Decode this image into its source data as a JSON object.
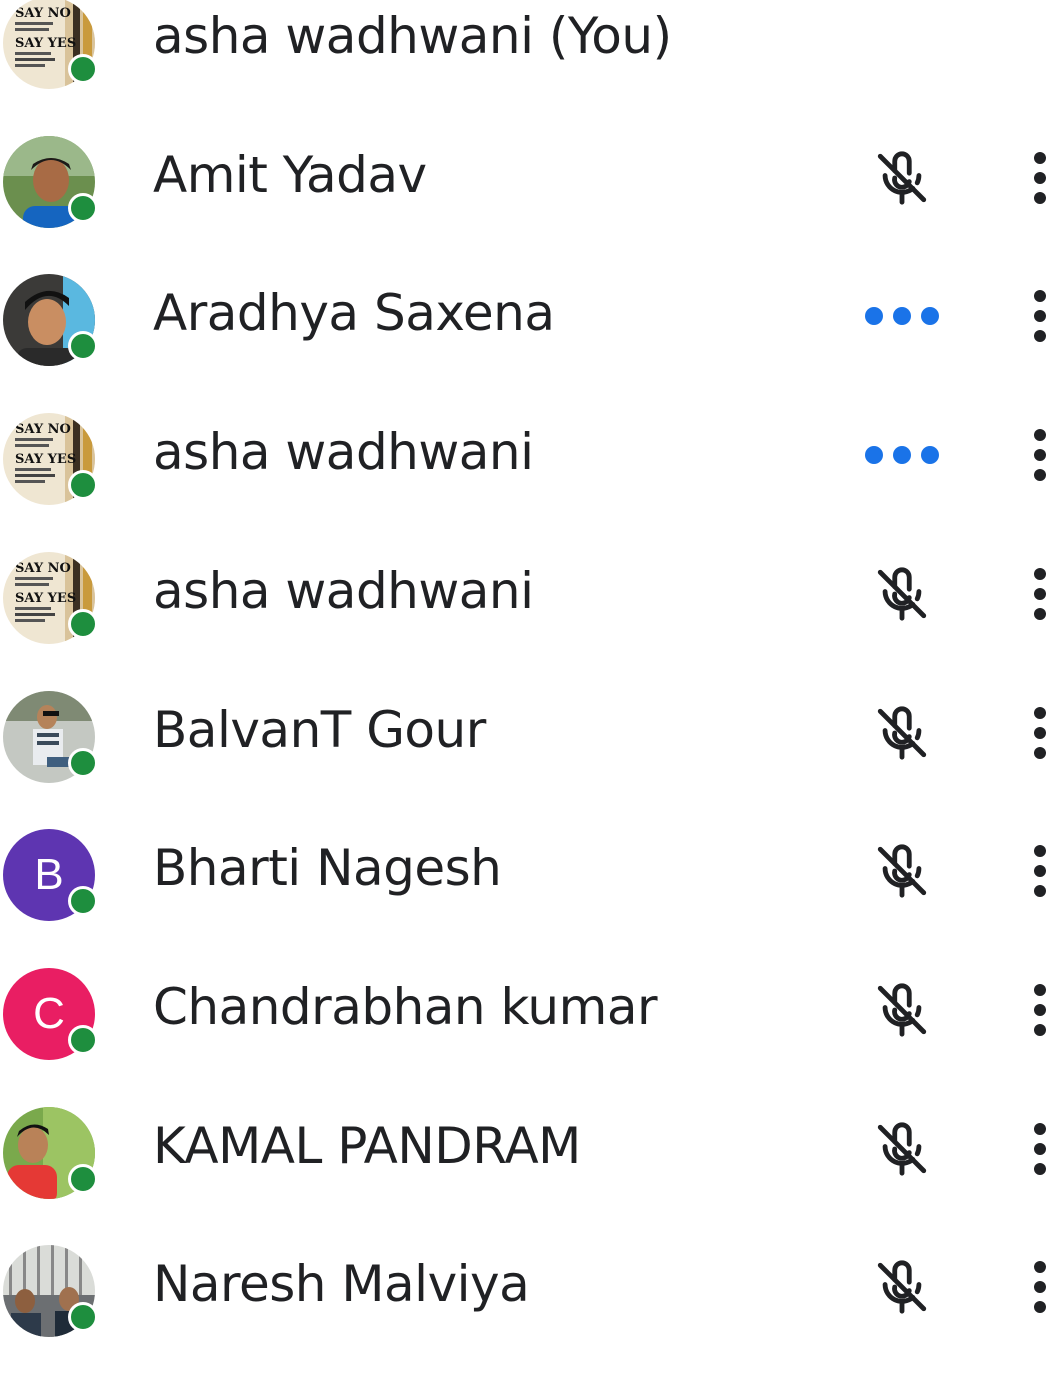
{
  "participants": [
    {
      "name": "asha wadhwani (You)",
      "avatar": "photo-poster",
      "online": true,
      "status": "none",
      "menu": false
    },
    {
      "name": "Amit Yadav",
      "avatar": "photo-person",
      "online": true,
      "status": "mic-off-icon",
      "menu": true
    },
    {
      "name": "Aradhya Saxena",
      "avatar": "photo-person",
      "online": true,
      "status": "speaking-dots-icon",
      "menu": true
    },
    {
      "name": "asha wadhwani",
      "avatar": "photo-poster",
      "online": true,
      "status": "speaking-dots-icon",
      "menu": true
    },
    {
      "name": "asha wadhwani",
      "avatar": "photo-poster",
      "online": true,
      "status": "mic-off-icon",
      "menu": true
    },
    {
      "name": "BalvanT Gour",
      "avatar": "photo-person",
      "online": true,
      "status": "mic-off-icon",
      "menu": true
    },
    {
      "name": "Bharti Nagesh",
      "avatar": "initial",
      "initial": "B",
      "avatar_color": "#5e35b1",
      "online": true,
      "status": "mic-off-icon",
      "menu": true
    },
    {
      "name": "Chandrabhan kumar",
      "avatar": "initial",
      "initial": "C",
      "avatar_color": "#e91e63",
      "online": true,
      "status": "mic-off-icon",
      "menu": true
    },
    {
      "name": "KAMAL PANDRAM",
      "avatar": "photo-person",
      "online": true,
      "status": "mic-off-icon",
      "menu": true
    },
    {
      "name": "Naresh Malviya",
      "avatar": "photo-group",
      "online": true,
      "status": "mic-off-icon",
      "menu": true
    }
  ],
  "colors": {
    "online": "#1e8e3e",
    "speaking": "#1a73e8",
    "text": "#202124"
  }
}
